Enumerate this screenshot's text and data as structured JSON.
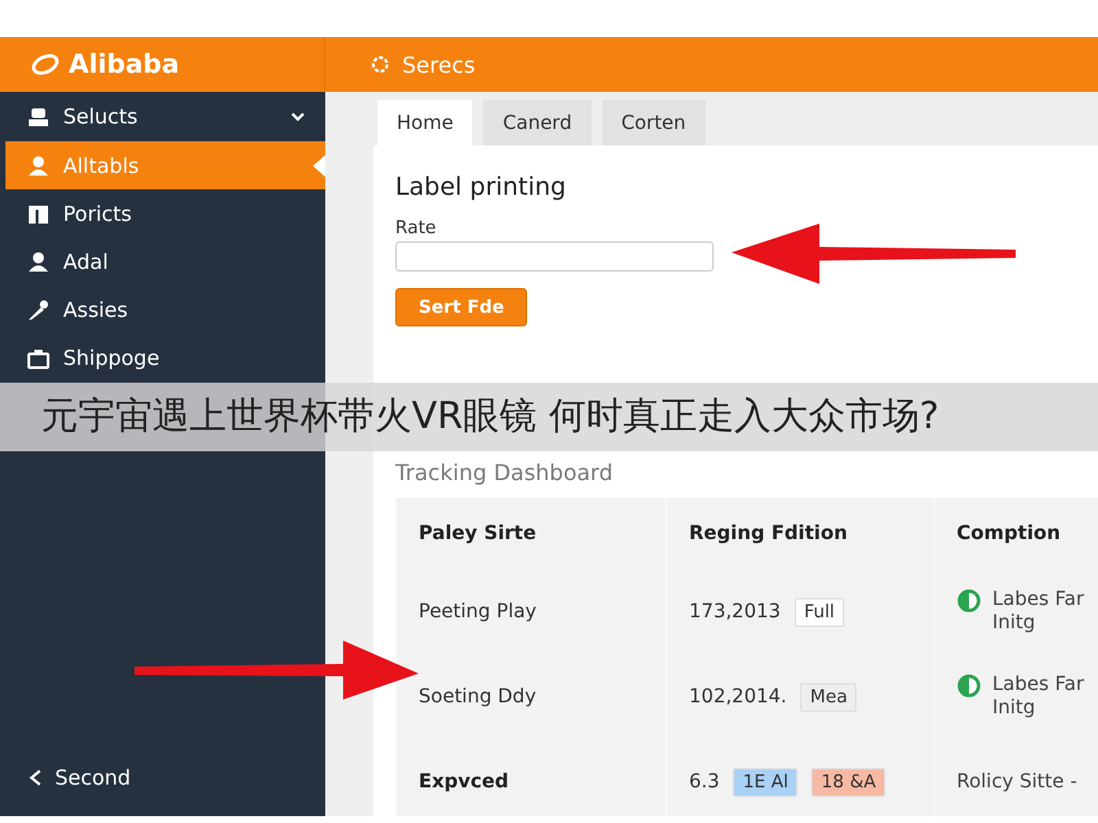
{
  "header": {
    "logo": "Alibaba",
    "title": "Serecs"
  },
  "sidebar": {
    "group": {
      "label": "Selucts",
      "expanded": true
    },
    "items": [
      {
        "label": "Alltabls",
        "selected": true
      },
      {
        "label": "Poricts",
        "selected": false
      },
      {
        "label": "Adal",
        "selected": false
      },
      {
        "label": "Assies",
        "selected": false
      },
      {
        "label": "Shippoge",
        "selected": false
      }
    ],
    "footer": {
      "label": "Second"
    }
  },
  "tabs": [
    {
      "label": "Home",
      "selected": true
    },
    {
      "label": "Canerd",
      "selected": false
    },
    {
      "label": "Corten",
      "selected": false
    }
  ],
  "form": {
    "heading": "Label printing",
    "field_label": "Rate",
    "button": "Sert Fde"
  },
  "dashboard": {
    "title": "Tracking Dashboard",
    "columns": [
      "Paley Sirte",
      "Reging Fdition",
      "Comption"
    ],
    "rows": [
      {
        "name": "Peeting Play",
        "emphasis": false,
        "value": "173,2013",
        "badges": [
          {
            "label": "Full",
            "color": "#ffffff"
          }
        ],
        "status": {
          "kind": "toggle",
          "on": true,
          "lines": [
            "Labes Far",
            "Initg"
          ]
        }
      },
      {
        "name": "Soeting Ddy",
        "emphasis": false,
        "value": "102,2014.",
        "badges": [
          {
            "label": "Mea",
            "color": "#eeeeee"
          }
        ],
        "status": {
          "kind": "toggle",
          "on": true,
          "lines": [
            "Labes Far",
            "Initg"
          ]
        }
      },
      {
        "name": "Expvced",
        "emphasis": true,
        "value": "6.3",
        "badges": [
          {
            "label": "1E Al",
            "color": "#a8d1f5"
          },
          {
            "label": "18 &A",
            "color": "#f7b9a3"
          }
        ],
        "status": {
          "kind": "text",
          "lines": [
            "Rolicy Sitte -"
          ]
        }
      }
    ]
  },
  "caption_banner": {
    "text": "元宇宙遇上世界杯带火VR眼镜 何时真正走入大众市场?"
  }
}
